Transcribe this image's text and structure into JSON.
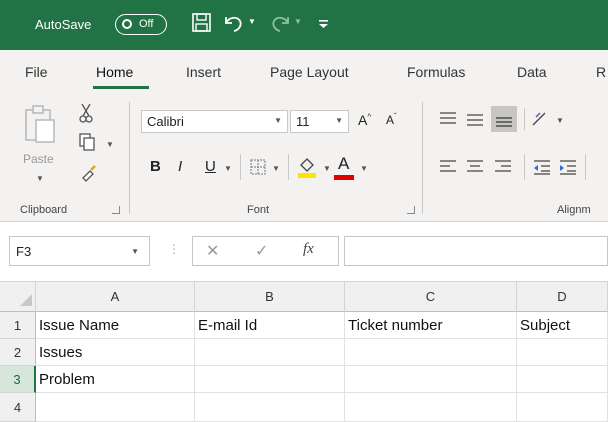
{
  "titlebar": {
    "autosave_label": "AutoSave",
    "autosave_state": "Off",
    "icons": [
      "save-icon",
      "undo-icon",
      "redo-icon",
      "customize-qat-icon"
    ]
  },
  "tabs": [
    "File",
    "Home",
    "Insert",
    "Page Layout",
    "Formulas",
    "Data",
    "R"
  ],
  "active_tab": "Home",
  "ribbon": {
    "clipboard": {
      "paste_label": "Paste",
      "group_label": "Clipboard"
    },
    "font": {
      "name": "Calibri",
      "size": "11",
      "bold": "B",
      "italic": "I",
      "underline": "U",
      "font_color_letter": "A",
      "fill_color": "#ffe400",
      "font_color": "#e00000",
      "group_label": "Font"
    },
    "alignment": {
      "group_label": "Alignm"
    }
  },
  "formula_bar": {
    "name_box": "F3",
    "fx_label": "fx",
    "value": ""
  },
  "sheet": {
    "columns": [
      "A",
      "B",
      "C",
      "D"
    ],
    "rows": [
      "1",
      "2",
      "3",
      "4"
    ],
    "cells": [
      [
        "Issue Name",
        "E-mail Id",
        "Ticket number",
        "Subject"
      ],
      [
        "Issues",
        "",
        "",
        ""
      ],
      [
        "Problem",
        "",
        "",
        ""
      ],
      [
        "",
        "",
        "",
        ""
      ]
    ],
    "selected_row": "3"
  },
  "colors": {
    "accent": "#217346"
  }
}
